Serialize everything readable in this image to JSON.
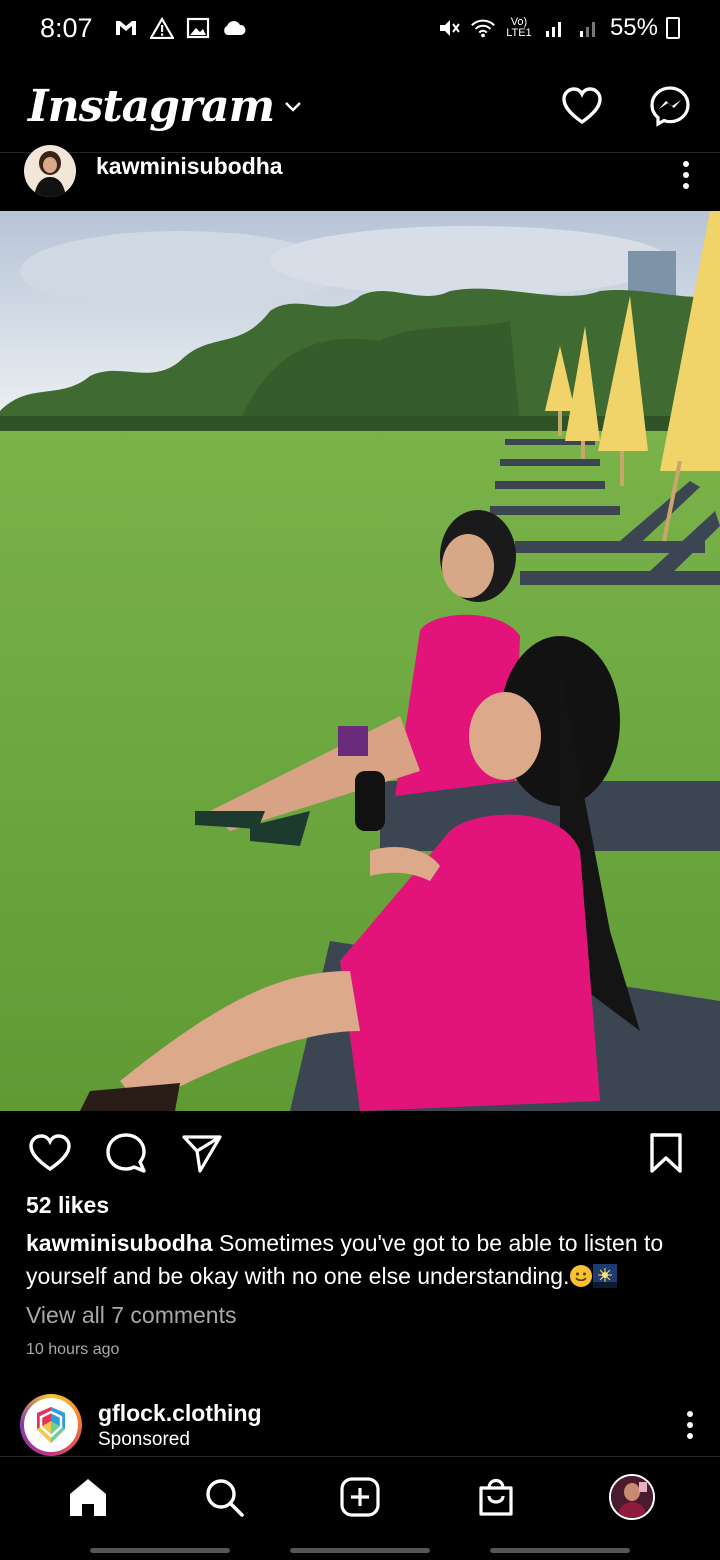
{
  "status_bar": {
    "time": "8:07",
    "battery": "55%",
    "battery_level": 0.55,
    "notification_icons": [
      "gmail-icon",
      "warning-icon",
      "gallery-icon",
      "cloud-icon"
    ],
    "network_label": "Vo) LTE1",
    "system_icons": [
      "mute-icon",
      "wifi-icon",
      "signal-icon",
      "signal-icon-2",
      "battery-icon"
    ]
  },
  "header": {
    "logo": "Instagram",
    "actions": [
      "heart-icon",
      "messenger-icon"
    ]
  },
  "post": {
    "username": "kawminisubodha",
    "likes": "52 likes",
    "caption_user": "kawminisubodha",
    "caption_text": " Sometimes you've got to be able to listen to yourself and be okay with no one else understanding.",
    "view_comments": "View all 7 comments",
    "timestamp": "10 hours ago",
    "actions": [
      "like-icon",
      "comment-icon",
      "share-icon",
      "bookmark-icon"
    ]
  },
  "next_post": {
    "username": "gflock.clothing",
    "label": "Sponsored"
  },
  "bottom_nav": [
    "home-icon",
    "search-icon",
    "create-icon",
    "shop-icon",
    "profile-avatar"
  ],
  "colors": {
    "background": "#000000",
    "text": "#ffffff",
    "secondary_text": "#a8a8a8",
    "dress_pink": "#e0157a",
    "grass_green": "#6fa83a",
    "umbrella_yellow": "#f3d66b"
  }
}
